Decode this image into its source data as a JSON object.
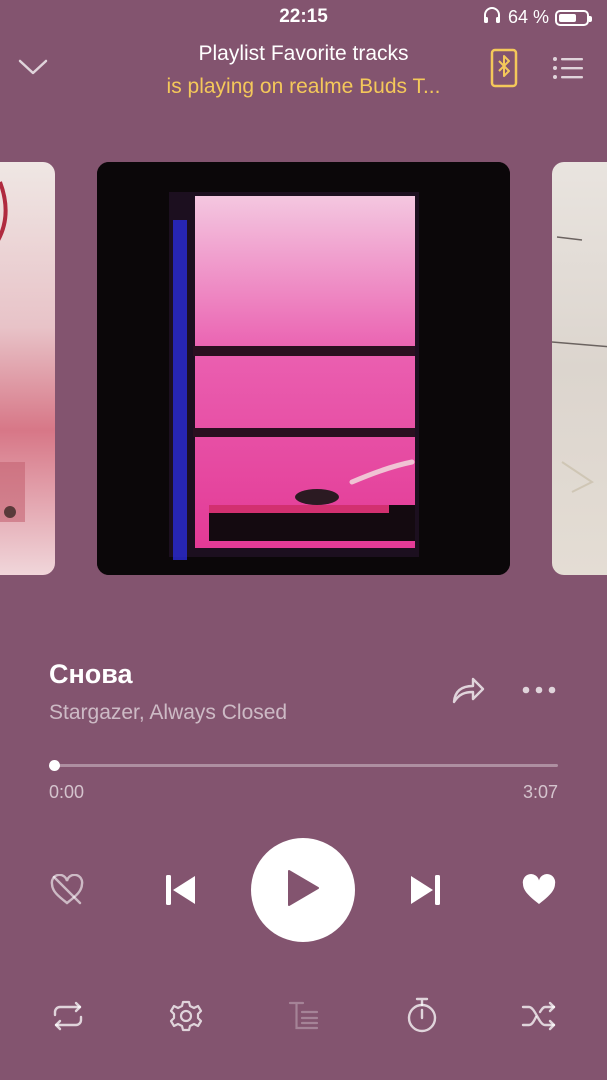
{
  "status": {
    "time": "22:15",
    "battery": "64 %",
    "battery_level": 0.64
  },
  "header": {
    "title": "Playlist Favorite tracks",
    "subtitle": "is playing on realme Buds T..."
  },
  "track": {
    "title": "Снова",
    "artist": "Stargazer, Always Closed",
    "current_time": "0:00",
    "duration": "3:07",
    "progress": 0.0
  },
  "colors": {
    "background": "#83546f",
    "accent": "#f4c85a",
    "text": "#ffffff"
  },
  "icons": {
    "collapse": "chevron-down-icon",
    "device": "bluetooth-phone-icon",
    "queue": "queue-list-icon",
    "share": "share-icon",
    "more": "more-dots-icon",
    "dislike": "dislike-heart-icon",
    "previous": "previous-track-icon",
    "play": "play-icon",
    "next": "next-track-icon",
    "like": "heart-icon",
    "repeat": "repeat-icon",
    "settings": "gear-icon",
    "lyrics": "lyrics-icon",
    "timer": "timer-icon",
    "shuffle": "shuffle-icon"
  }
}
